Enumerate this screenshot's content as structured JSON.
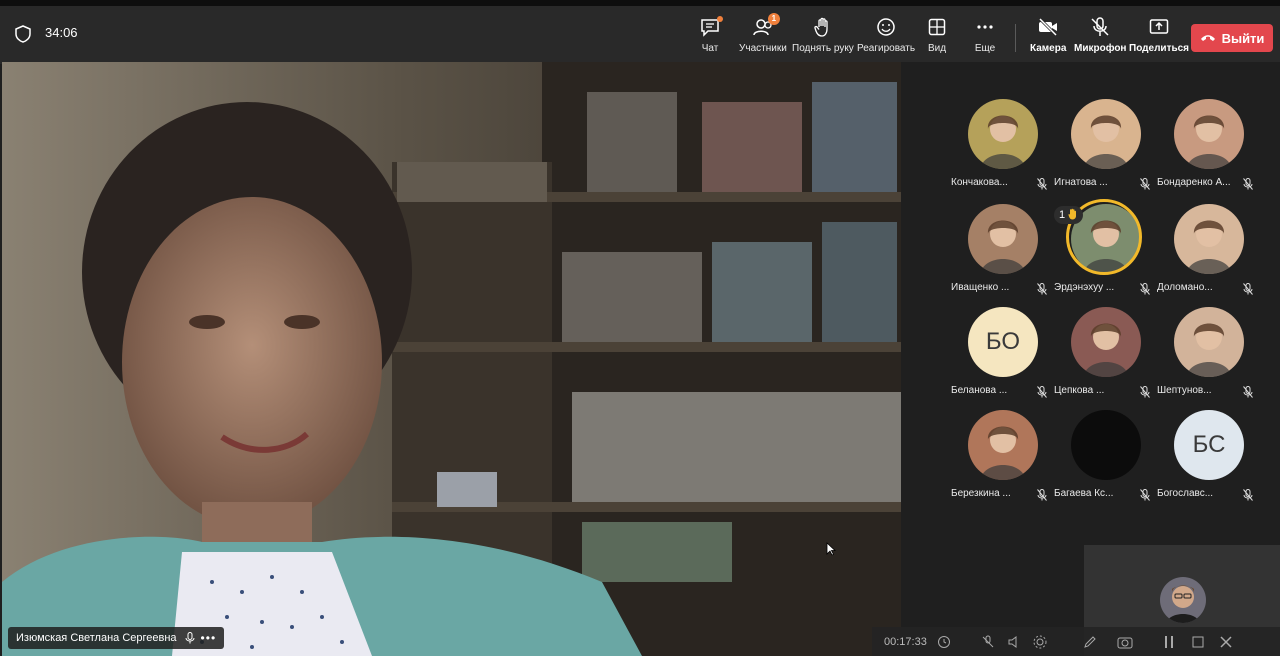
{
  "meeting": {
    "timer": "34:06",
    "speaker_name": "Изюмская Светлана Сергеевна"
  },
  "toolbar": {
    "chat": "Чат",
    "participants": "Участники",
    "participants_badge": "1",
    "raise_hand": "Поднять руку",
    "react": "Реагировать",
    "view": "Вид",
    "more": "Еще",
    "camera": "Камера",
    "mic": "Микрофон",
    "share": "Поделиться",
    "leave": "Выйти"
  },
  "participants": [
    {
      "name": "Кончакова...",
      "type": "photo",
      "color": "#b5a15a"
    },
    {
      "name": "Игнатова ...",
      "type": "photo",
      "color": "#d9b48f"
    },
    {
      "name": "Бондаренко А...",
      "type": "photo",
      "color": "#c89a80"
    },
    {
      "name": "Иващенко ...",
      "type": "photo",
      "color": "#a58066"
    },
    {
      "name": "Эрдэнэхуу ...",
      "type": "photo",
      "color": "#7d8d6e",
      "hand_raised": true,
      "hand_count": "1"
    },
    {
      "name": "Доломано...",
      "type": "photo",
      "color": "#d7b79b"
    },
    {
      "name": "Беланова ...",
      "type": "initials",
      "initials": "БО",
      "bg": "#f5e6c0"
    },
    {
      "name": "Цепкова ...",
      "type": "photo",
      "color": "#8a5a54"
    },
    {
      "name": "Шептунов...",
      "type": "photo",
      "color": "#d2b39a"
    },
    {
      "name": "Березкина ...",
      "type": "photo",
      "color": "#b0765a"
    },
    {
      "name": "Багаева Кс...",
      "type": "dark",
      "bg": "#0c0c0c"
    },
    {
      "name": "Богославс...",
      "type": "initials",
      "initials": "БС",
      "bg": "#dfe7ee"
    }
  ],
  "recording": {
    "time": "00:17:33"
  },
  "colors": {
    "leave_button": "#e3474d",
    "hand_ring": "#f2b92a",
    "badge": "#f0803c"
  }
}
